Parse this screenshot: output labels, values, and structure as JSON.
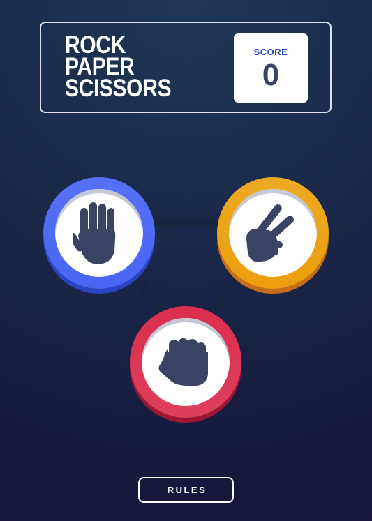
{
  "header": {
    "title_lines": [
      "ROCK",
      "PAPER",
      "SCISSORS"
    ],
    "score_label": "SCORE",
    "score_value": "0"
  },
  "choices": [
    {
      "id": "paper",
      "icon": "paper-hand-icon",
      "color": "#4865f4",
      "shadow": "#2a45c2"
    },
    {
      "id": "scissors",
      "icon": "scissors-hand-icon",
      "color": "#ec9e0e",
      "shadow": "#c76c1b"
    },
    {
      "id": "rock",
      "icon": "rock-fist-icon",
      "color": "#dc2e4e",
      "shadow": "#9d1634"
    }
  ],
  "footer": {
    "rules_label": "RULES"
  },
  "colors": {
    "background_top": "#1f3756",
    "background_bottom": "#141539",
    "score_label": "#2a46c0",
    "score_value": "#3b4363",
    "hand": "#3b4363"
  }
}
